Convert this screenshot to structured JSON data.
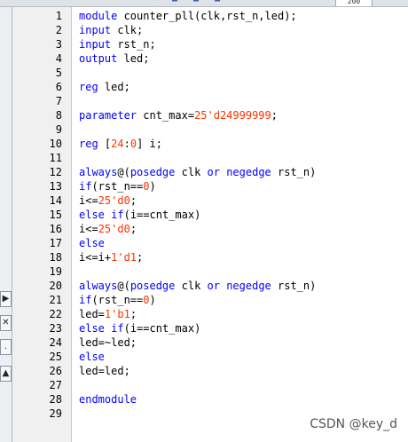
{
  "toolbar": {
    "icons": [
      "arrow-icon",
      "arrow-icon",
      "arrow-icon",
      "dropdown-icon",
      "save-icon",
      "copy-icon",
      "paste-icon",
      "undo-icon",
      "redo-icon",
      "find-icon",
      "zoom-icon"
    ],
    "zoom_value": "200"
  },
  "left_strip": {
    "buttons": [
      {
        "name": "expand-right-button",
        "glyph": "▶"
      },
      {
        "name": "close-panel-button",
        "glyph": "✕"
      },
      {
        "name": "dot-button",
        "glyph": "."
      },
      {
        "name": "scroll-up-button",
        "glyph": "▲"
      }
    ]
  },
  "editor": {
    "line_numbers": [
      "1",
      "2",
      "3",
      "4",
      "5",
      "6",
      "7",
      "8",
      "9",
      "10",
      "11",
      "12",
      "13",
      "14",
      "15",
      "16",
      "17",
      "18",
      "19",
      "20",
      "21",
      "22",
      "23",
      "24",
      "25",
      "26",
      "27",
      "28",
      "29"
    ],
    "lines": [
      [
        {
          "t": "module",
          "k": "kw"
        },
        {
          "t": " counter_pll(clk,rst_n,led);",
          "k": "txt"
        }
      ],
      [
        {
          "t": "input",
          "k": "kw"
        },
        {
          "t": " clk;",
          "k": "txt"
        }
      ],
      [
        {
          "t": "input",
          "k": "kw"
        },
        {
          "t": " rst_n;",
          "k": "txt"
        }
      ],
      [
        {
          "t": "output",
          "k": "kw"
        },
        {
          "t": " led;",
          "k": "txt"
        }
      ],
      [],
      [
        {
          "t": "reg",
          "k": "kw"
        },
        {
          "t": " led;",
          "k": "txt"
        }
      ],
      [],
      [
        {
          "t": "parameter",
          "k": "kw"
        },
        {
          "t": " cnt_max=",
          "k": "txt"
        },
        {
          "t": "25'd24999999",
          "k": "num"
        },
        {
          "t": ";",
          "k": "txt"
        }
      ],
      [],
      [
        {
          "t": "reg",
          "k": "kw"
        },
        {
          "t": " [",
          "k": "txt"
        },
        {
          "t": "24",
          "k": "num"
        },
        {
          "t": ":",
          "k": "txt"
        },
        {
          "t": "0",
          "k": "num"
        },
        {
          "t": "] i;",
          "k": "txt"
        }
      ],
      [],
      [
        {
          "t": "always",
          "k": "kw"
        },
        {
          "t": "@(",
          "k": "txt"
        },
        {
          "t": "posedge",
          "k": "kw"
        },
        {
          "t": " clk ",
          "k": "txt"
        },
        {
          "t": "or",
          "k": "kw"
        },
        {
          "t": " ",
          "k": "txt"
        },
        {
          "t": "negedge",
          "k": "kw"
        },
        {
          "t": " rst_n)",
          "k": "txt"
        }
      ],
      [
        {
          "t": "if",
          "k": "kw"
        },
        {
          "t": "(rst_n==",
          "k": "txt"
        },
        {
          "t": "0",
          "k": "num"
        },
        {
          "t": ")",
          "k": "txt"
        }
      ],
      [
        {
          "t": "i<=",
          "k": "txt"
        },
        {
          "t": "25'd0",
          "k": "num"
        },
        {
          "t": ";",
          "k": "txt"
        }
      ],
      [
        {
          "t": "else",
          "k": "kw"
        },
        {
          "t": " ",
          "k": "txt"
        },
        {
          "t": "if",
          "k": "kw"
        },
        {
          "t": "(i==cnt_max)",
          "k": "txt"
        }
      ],
      [
        {
          "t": "i<=",
          "k": "txt"
        },
        {
          "t": "25'd0",
          "k": "num"
        },
        {
          "t": ";",
          "k": "txt"
        }
      ],
      [
        {
          "t": "else",
          "k": "kw"
        }
      ],
      [
        {
          "t": "i<=i+",
          "k": "txt"
        },
        {
          "t": "1'd1",
          "k": "num"
        },
        {
          "t": ";",
          "k": "txt"
        }
      ],
      [],
      [
        {
          "t": "always",
          "k": "kw"
        },
        {
          "t": "@(",
          "k": "txt"
        },
        {
          "t": "posedge",
          "k": "kw"
        },
        {
          "t": " clk ",
          "k": "txt"
        },
        {
          "t": "or",
          "k": "kw"
        },
        {
          "t": " ",
          "k": "txt"
        },
        {
          "t": "negedge",
          "k": "kw"
        },
        {
          "t": " rst_n)",
          "k": "txt"
        }
      ],
      [
        {
          "t": "if",
          "k": "kw"
        },
        {
          "t": "(rst_n==",
          "k": "txt"
        },
        {
          "t": "0",
          "k": "num"
        },
        {
          "t": ")",
          "k": "txt"
        }
      ],
      [
        {
          "t": "led=",
          "k": "txt"
        },
        {
          "t": "1'b1",
          "k": "num"
        },
        {
          "t": ";",
          "k": "txt"
        }
      ],
      [
        {
          "t": "else",
          "k": "kw"
        },
        {
          "t": " ",
          "k": "txt"
        },
        {
          "t": "if",
          "k": "kw"
        },
        {
          "t": "(i==cnt_max)",
          "k": "txt"
        }
      ],
      [
        {
          "t": "led=~led;",
          "k": "txt"
        }
      ],
      [
        {
          "t": "else",
          "k": "kw"
        }
      ],
      [
        {
          "t": "led=led;",
          "k": "txt"
        }
      ],
      [],
      [
        {
          "t": "endmodule",
          "k": "kw"
        }
      ],
      []
    ],
    "colors": {
      "keyword": "#0000ff",
      "number": "#ff3300",
      "text": "#000000",
      "gutter": "#f0f0f0"
    }
  },
  "watermark": "CSDN @key_d"
}
